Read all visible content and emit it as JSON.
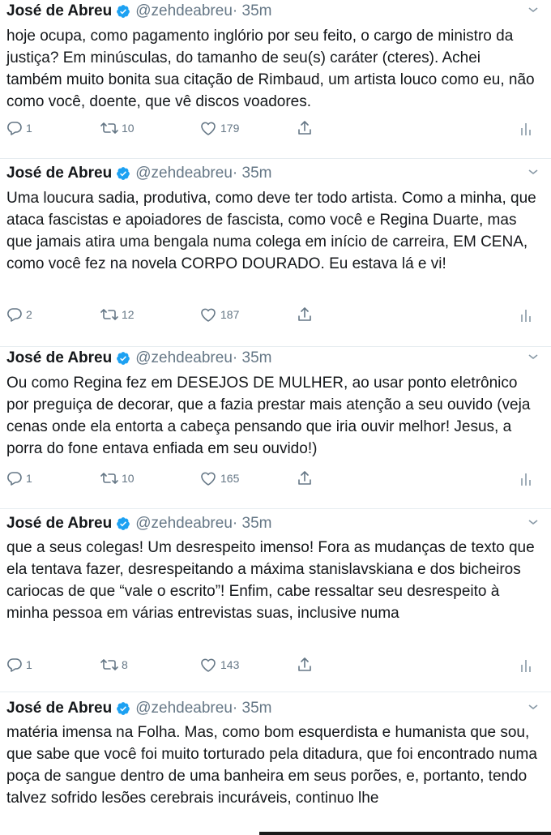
{
  "tweets": [
    {
      "name": "José de Abreu",
      "handle": "@zehdeabreu",
      "time": "· 35m",
      "text": "hoje ocupa, como pagamento inglório por seu feito, o cargo de ministro da justiça? Em minúsculas, do tamanho de seu(s) caráter (cteres). Achei também muito bonita sua citação de Rimbaud, um artista louco como eu, não como você, doente, que vê discos voadores.",
      "replies": "1",
      "retweets": "10",
      "likes": "179"
    },
    {
      "name": "José de Abreu",
      "handle": "@zehdeabreu",
      "time": "· 35m",
      "text": "Uma loucura sadia, produtiva, como deve ter todo artista. Como a minha, que ataca fascistas e apoiadores de fascista, como você e Regina Duarte, mas que jamais atira uma bengala numa colega em início de carreira, EM CENA, como você fez na novela CORPO DOURADO. Eu estava lá e vi!",
      "replies": "2",
      "retweets": "12",
      "likes": "187"
    },
    {
      "name": "José de Abreu",
      "handle": "@zehdeabreu",
      "time": "· 35m",
      "text": "Ou como Regina fez em DESEJOS DE MULHER, ao usar ponto eletrônico por preguiça de decorar, que a fazia prestar mais atenção a seu ouvido (veja cenas onde ela entorta a cabeça pensando que iria ouvir melhor! Jesus, a porra do fone entava enfiada em seu ouvido!)",
      "replies": "1",
      "retweets": "10",
      "likes": "165"
    },
    {
      "name": "José de Abreu",
      "handle": "@zehdeabreu",
      "time": "· 35m",
      "text": "que a seus colegas! Um desrespeito imenso! Fora as mudanças de texto que ela tentava fazer, desrespeitando a máxima stanislavskiana e dos bicheiros cariocas de que “vale o escrito”! Enfim, cabe ressaltar seu desrespeito à minha pessoa em várias entrevistas suas, inclusive numa",
      "replies": "1",
      "retweets": "8",
      "likes": "143"
    },
    {
      "name": "José de Abreu",
      "handle": "@zehdeabreu",
      "time": "· 35m",
      "text": "matéria imensa na Folha. Mas, como bom esquerdista e humanista que sou, que sabe que você foi muito torturado pela ditadura, que foi encontrado numa poça de sangue dentro de uma banheira em seus porões, e, portanto, tendo talvez sofrido lesões cerebrais incuráveis, continuo lhe"
    }
  ],
  "colors": {
    "verified": "#1da1f2",
    "secondary": "#657786",
    "text": "#14171a"
  },
  "icons": [
    "verified-badge-icon",
    "chevron-down-icon",
    "reply-icon",
    "retweet-icon",
    "like-icon",
    "share-icon",
    "analytics-icon"
  ]
}
